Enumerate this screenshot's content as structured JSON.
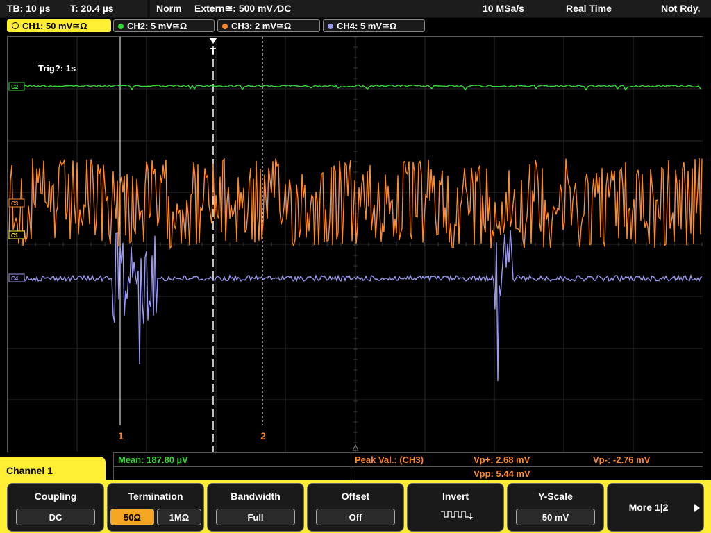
{
  "status_bar": {
    "timebase": "TB: 10 µs",
    "trigger_time": "T: 20.4 µs",
    "mode": "Norm",
    "trigger_source": "Extern≅: 500 mV ⁄DC",
    "sample_rate": "10 MSa/s",
    "acq_mode": "Real Time",
    "state": "Not Rdy."
  },
  "channel_tabs": [
    {
      "label": "CH1: 50 mV≅Ω",
      "color": "#ffee33"
    },
    {
      "label": "CH2: 5 mV≅Ω",
      "color": "#33dd33"
    },
    {
      "label": "CH3: 2 mV≅Ω",
      "color": "#ff8a2a"
    },
    {
      "label": "CH4: 5 mV≅Ω",
      "color": "#9a9af0"
    }
  ],
  "screen": {
    "trigger_text": "Trig?: 1s",
    "trigger_marker": "T",
    "cursor1_label": "1",
    "cursor2_label": "2",
    "ch_markers": [
      {
        "label": "C2",
        "color": "#33dd33"
      },
      {
        "label": "C3",
        "color": "#ff8a2a"
      },
      {
        "label": "C1",
        "color": "#ffee33"
      },
      {
        "label": "C4",
        "color": "#9a9af0"
      }
    ]
  },
  "measurements": {
    "mean": "Mean: 187.80 µV",
    "peak_label": "Peak Val.:  (CH3)",
    "vp_plus": "Vp+: 2.68 mV",
    "vp_minus": "Vp-: -2.76 mV",
    "vpp": "Vpp: 5.44 mV"
  },
  "channel_panel": {
    "title": "Channel 1"
  },
  "softkeys": {
    "coupling": {
      "title": "Coupling",
      "value": "DC"
    },
    "termination": {
      "title": "Termination",
      "opt1": "50Ω",
      "opt2": "1MΩ"
    },
    "bandwidth": {
      "title": "Bandwidth",
      "value": "Full"
    },
    "offset": {
      "title": "Offset",
      "value": "Off"
    },
    "invert": {
      "title": "Invert"
    },
    "yscale": {
      "title": "Y-Scale",
      "value": "50 mV"
    },
    "more": {
      "label": "More 1|2"
    }
  },
  "colors": {
    "ch1": "#ffee33",
    "ch2": "#33dd33",
    "ch3": "#ff8a2a",
    "ch4": "#9a9af0",
    "accent": "#ffee33"
  }
}
